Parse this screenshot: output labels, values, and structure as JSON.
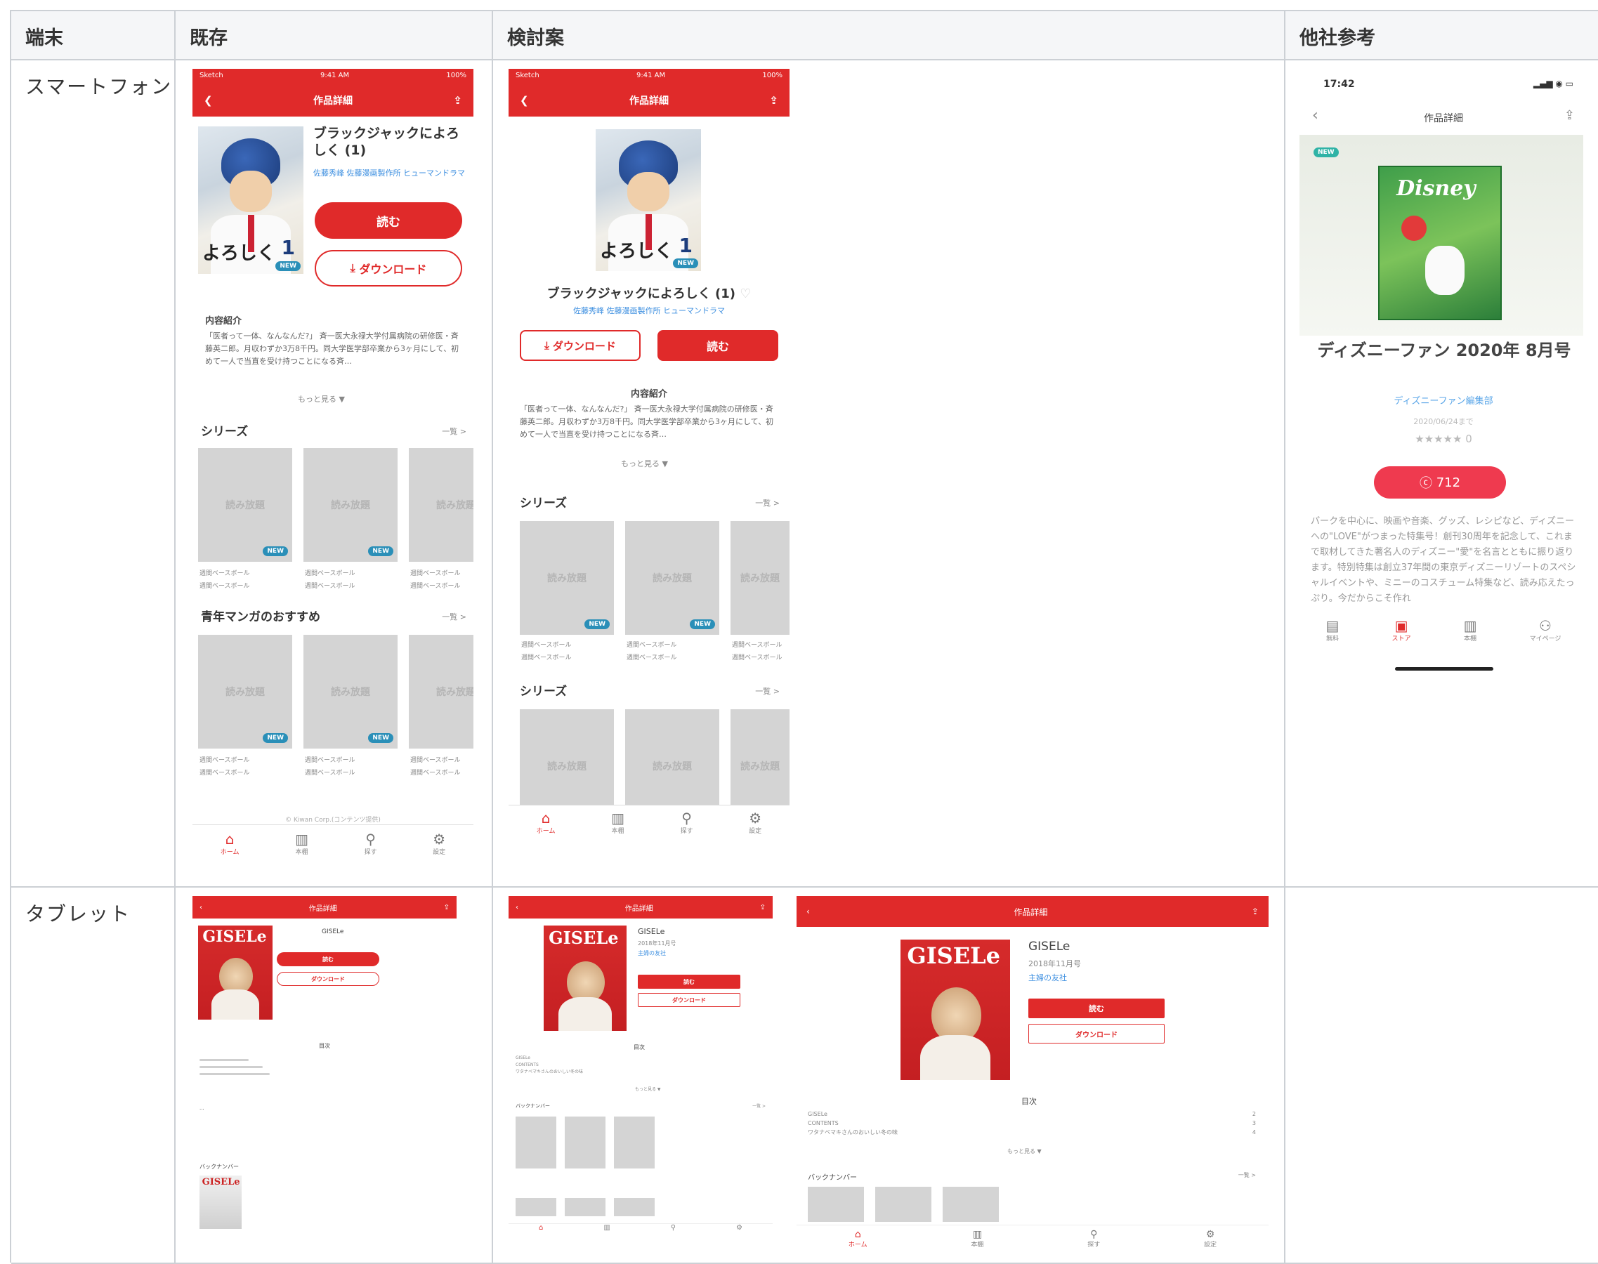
{
  "table": {
    "headers": [
      "端末",
      "既存",
      "検討案",
      "他社参考"
    ],
    "rows": [
      "スマートフォン",
      "タブレット"
    ]
  },
  "phone": {
    "status_time": "9:41 AM",
    "status_carrier": "Sketch",
    "status_battery": "100%",
    "nav_title": "作品詳細",
    "book_title": "ブラックジャックによろしく (1)",
    "book_title_existing": "ブラックジャックによろしく (1)",
    "authors": "佐藤秀峰  佐藤漫画製作所  ヒューマンドラマ",
    "cover_title": "よろしく",
    "cover_number": "1",
    "new_badge": "NEW",
    "read_btn": "読む",
    "download_btn": "ダウンロード",
    "intro_heading": "内容紹介",
    "intro_text": "「医者って一体、なんなんだ?」 斉一医大永禄大学付属病院の研修医・斉藤英二郎。月収わずか3万8千円。同大学医学部卒業から3ヶ月にして、初めて一人で当直を受け持つことになる斉…",
    "more_link": "もっと見る ▼",
    "series_heading": "シリーズ",
    "seinen_heading": "青年マンガのおすすめ",
    "see_all": "一覧 >",
    "placeholder_tile": "読み放題",
    "tile_caption_1": "週間ベースボール",
    "tile_caption_2": "週間ベースボール",
    "copyright": "© Kiwan Corp.(コンテンツ提供)",
    "tabs": [
      "ホーム",
      "本棚",
      "探す",
      "設定"
    ]
  },
  "other": {
    "status_time": "17:42",
    "nav_title": "作品詳細",
    "new_badge": "NEW",
    "mag_logo": "Disney",
    "title": "ディズニーファン 2020年 8月号",
    "publisher": "ディズニーファン編集部",
    "date": "2020/06/24まで",
    "stars": "★★★★★ 0",
    "coin_btn": "712",
    "desc": "パークを中心に、映画や音楽、グッズ、レシピなど、ディズニーへの\"LOVE\"がつまった特集号！創刊30周年を記念して、これまで取材してきた著名人のディズニー\"愛\"を名言とともに振り返ります。特別特集は創立37年間の東京ディズニーリゾートのスペシャルイベントや、ミニーのコスチューム特集など、読み応えたっぷり。今だからこそ作れ",
    "tabs": [
      "無料",
      "ストア",
      "本棚",
      "マイページ"
    ]
  },
  "tablet": {
    "nav_title": "作品詳細",
    "mag_logo": "GISELe",
    "title": "GISELe",
    "date": "2018年11月号",
    "publisher": "主婦の友社",
    "read_btn": "読む",
    "download_btn": "ダウンロード",
    "toc_heading": "目次",
    "toc_items": [
      "GISELe",
      "CONTENTS",
      "ワタナベマキさんのおいしい冬の味"
    ],
    "more_link": "もっと見る ▼",
    "backnumber": "バックナンバー",
    "see_all": "一覧 >",
    "tabs": [
      "ホーム",
      "本棚",
      "探す",
      "設定"
    ]
  }
}
